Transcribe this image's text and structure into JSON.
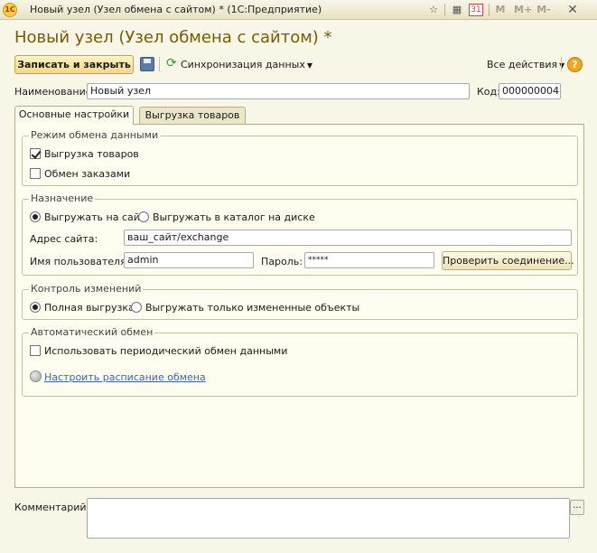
{
  "window": {
    "title": "Новый узел (Узел обмена с сайтом) * (1С:Предприятие)",
    "logo": "1C",
    "toolbar": {
      "m": "M",
      "m_plus": "M+",
      "m_minus": "M-",
      "calendar_day": "31"
    }
  },
  "form": {
    "title": "Новый узел (Узел обмена с сайтом) *",
    "save_close_label": "Записать и закрыть",
    "sync_label": "Синхронизация данных",
    "all_actions_label": "Все действия",
    "help_label": "?",
    "name_label": "Наименование:",
    "name_value": "Новый узел",
    "code_label": "Код:",
    "code_value": "000000004"
  },
  "tabs": [
    {
      "label": "Основные настройки",
      "active": true
    },
    {
      "label": "Выгрузка товаров",
      "active": false
    }
  ],
  "exchange_mode": {
    "title": "Режим обмена данными",
    "options": [
      {
        "label": "Выгрузка товаров",
        "checked": true
      },
      {
        "label": "Обмен заказами",
        "checked": false
      }
    ]
  },
  "destination": {
    "title": "Назначение",
    "radio_site": "Выгружать на сайт",
    "radio_disk": "Выгружать в каталог на диске",
    "selected": "site",
    "site_address_label": "Адрес сайта:",
    "site_address_value": "ваш_сайт/exchange",
    "username_label": "Имя пользователя:",
    "username_value": "admin",
    "password_label": "Пароль:",
    "password_value": "*****",
    "check_connection_label": "Проверить соединение..."
  },
  "change_control": {
    "title": "Контроль изменений",
    "radio_full": "Полная выгрузка",
    "radio_changed": "Выгружать только измененные объекты",
    "selected": "full"
  },
  "auto_exchange": {
    "title": "Автоматический обмен",
    "periodic_label": "Использовать периодический обмен данными",
    "periodic_checked": false,
    "schedule_link": "Настроить расписание обмена"
  },
  "comment": {
    "label": "Комментарий:",
    "value": "",
    "dots_label": "..."
  },
  "colors": {
    "title_color": "#7a5a00",
    "background": "#f8f6e6",
    "panel": "#fffdf0",
    "link": "#3d63b3"
  },
  "icons": [
    "app-logo-icon",
    "favorite-icon",
    "calculator-icon",
    "calendar-icon",
    "close-icon",
    "save-icon",
    "sync-icon",
    "help-icon",
    "globe-icon"
  ]
}
